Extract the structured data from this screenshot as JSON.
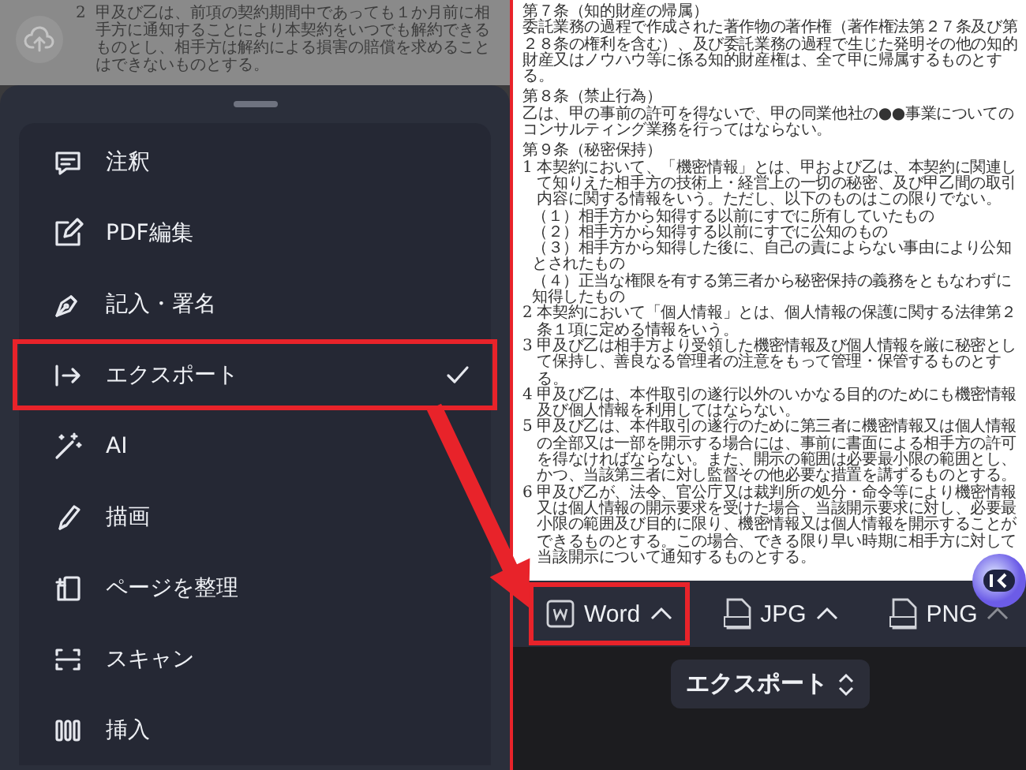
{
  "background_document": {
    "paragraphs": [
      {
        "number": "2",
        "text": "甲及び乙は、前項の契約期間中であっても１か月前に相手方に通知することにより本契約をいつでも解約できるものとし、相手方は解約による損害の賠償を求めることはできないものとする。"
      }
    ]
  },
  "tool_menu": {
    "items": [
      {
        "kind": "comment",
        "label": "注釈",
        "selected": false,
        "highlighted": false
      },
      {
        "kind": "edit",
        "label": "PDF編集",
        "selected": false,
        "highlighted": false
      },
      {
        "kind": "sign",
        "label": "記入・署名",
        "selected": false,
        "highlighted": false
      },
      {
        "kind": "export",
        "label": "エクスポート",
        "selected": true,
        "highlighted": true
      },
      {
        "kind": "ai",
        "label": "AI",
        "selected": false,
        "highlighted": false
      },
      {
        "kind": "draw",
        "label": "描画",
        "selected": false,
        "highlighted": false
      },
      {
        "kind": "pages",
        "label": "ページを整理",
        "selected": false,
        "highlighted": false
      },
      {
        "kind": "scan",
        "label": "スキャン",
        "selected": false,
        "highlighted": false
      },
      {
        "kind": "insert",
        "label": "挿入",
        "selected": false,
        "highlighted": false
      }
    ]
  },
  "document": {
    "blocks": [
      {
        "kind": "heading",
        "text": "第７条（知的財産の帰属）"
      },
      {
        "kind": "paragraph",
        "text": "委託業務の過程で作成された著作物の著作権（著作権法第２７条及び第２８条の権利を含む）、及び委託業務の過程で生じた発明その他の知的財産又はノウハウ等に係る知的財産権は、全て甲に帰属するものとする。"
      },
      {
        "kind": "heading",
        "text": "第８条（禁止行為）"
      },
      {
        "kind": "paragraph",
        "text": "乙は、甲の事前の許可を得ないで、甲の同業他社の●●事業についてのコンサルティング業務を行ってはならない。"
      },
      {
        "kind": "heading",
        "text": "第９条（秘密保持）"
      },
      {
        "kind": "numbered",
        "number": "1",
        "text": "本契約において、「機密情報」とは、甲および乙は、本契約に関連して知りえた相手方の技術上・経営上の一切の秘密、及び甲乙間の取引内容に関する情報をいう。ただし、以下のものはこの限りでない。"
      },
      {
        "kind": "subitem",
        "text": "（１）相手方から知得する以前にすでに所有していたもの"
      },
      {
        "kind": "subitem",
        "text": "（２）相手方から知得する以前にすでに公知のもの"
      },
      {
        "kind": "subitem",
        "text": "（３）相手方から知得した後に、自己の責によらない事由により公知とされたもの"
      },
      {
        "kind": "subitem",
        "text": "（４）正当な権限を有する第三者から秘密保持の義務をともなわずに知得したもの"
      },
      {
        "kind": "numbered",
        "number": "2",
        "text": "本契約において「個人情報」とは、個人情報の保護に関する法律第２条１項に定める情報をいう。"
      },
      {
        "kind": "numbered",
        "number": "3",
        "text": "甲及び乙は相手方より受領した機密情報及び個人情報を厳に秘密として保持し、善良なる管理者の注意をもって管理・保管するものとする。"
      },
      {
        "kind": "numbered",
        "number": "4",
        "text": "甲及び乙は、本件取引の遂行以外のいかなる目的のためにも機密情報及び個人情報を利用してはならない。"
      },
      {
        "kind": "numbered",
        "number": "5",
        "text": "甲及び乙は、本件取引の遂行のために第三者に機密情報又は個人情報の全部又は一部を開示する場合には、事前に書面による相手方の許可を得なければならない。また、開示の範囲は必要最小限の範囲とし、かつ、当該第三者に対し監督その他必要な措置を講ずるものとする。"
      },
      {
        "kind": "numbered",
        "number": "6",
        "text": "甲及び乙が、法令、官公庁又は裁判所の処分・命令等により機密情報又は個人情報の開示要求を受けた場合、当該開示要求に対し、必要最小限の範囲及び目的に限り、機密情報又は個人情報を開示することができるものとする。この場合、できる限り早い時期に相手方に対して当該開示について通知するものとする。"
      }
    ]
  },
  "export_toolbar": {
    "items": [
      {
        "kind": "word",
        "label": "Word",
        "highlighted": true
      },
      {
        "kind": "jpg",
        "label": "JPG",
        "highlighted": false
      },
      {
        "kind": "png",
        "label": "PNG",
        "highlighted": false
      }
    ]
  },
  "mode_selector": {
    "label": "エクスポート"
  }
}
